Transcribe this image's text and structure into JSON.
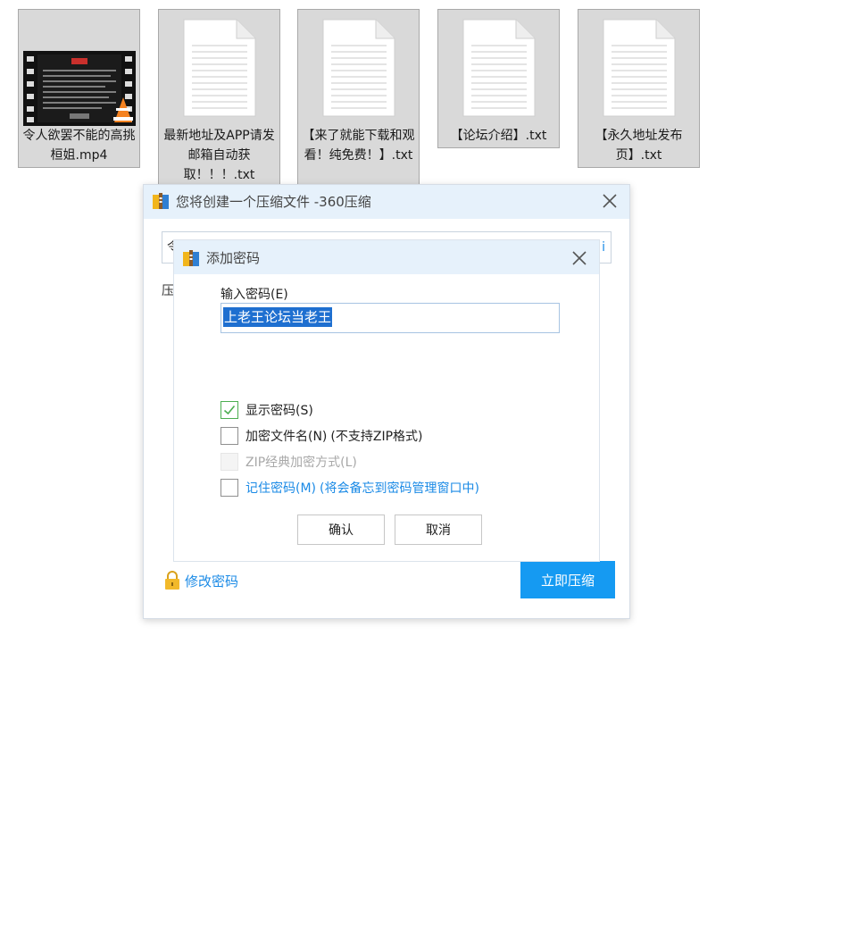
{
  "files": [
    {
      "name": "令人欲罢不能的高挑桓姐.mp4",
      "icon": "video-thumbnail-icon"
    },
    {
      "name": "最新地址及APP请发邮箱自动获取！！！.txt",
      "icon": "text-document-icon"
    },
    {
      "name": "【来了就能下载和观看！纯免费！】.txt",
      "icon": "text-document-icon"
    },
    {
      "name": "【论坛介绍】.txt",
      "icon": "text-document-icon"
    },
    {
      "name": "【永久地址发布页】.txt",
      "icon": "text-document-icon"
    }
  ],
  "compress_dialog": {
    "title": "您将创建一个压缩文件 -360压缩",
    "path_prefix": "令",
    "path_tail": "i",
    "behind_label": "压",
    "modify_password": "修改密码",
    "compress_now": "立即压缩"
  },
  "password_dialog": {
    "title": "添加密码",
    "input_label": "输入密码(E)",
    "password_value": "上老王论坛当老王",
    "options": [
      {
        "label": "显示密码(S)",
        "note": "",
        "state": "checked"
      },
      {
        "label": "加密文件名(N)",
        "note": "(不支持ZIP格式)",
        "state": "unchecked"
      },
      {
        "label": "ZIP经典加密方式(L)",
        "note": "",
        "state": "disabled"
      },
      {
        "label": "记住密码(M)",
        "note": "(将会备忘到密码管理窗口中)",
        "state": "unchecked"
      }
    ],
    "ok": "确认",
    "cancel": "取消"
  },
  "colors": {
    "accent": "#159af2",
    "link": "#1a8ae6",
    "titlebar": "#e6f1fb",
    "selection": "#1e6fd0",
    "check": "#4cae50"
  }
}
